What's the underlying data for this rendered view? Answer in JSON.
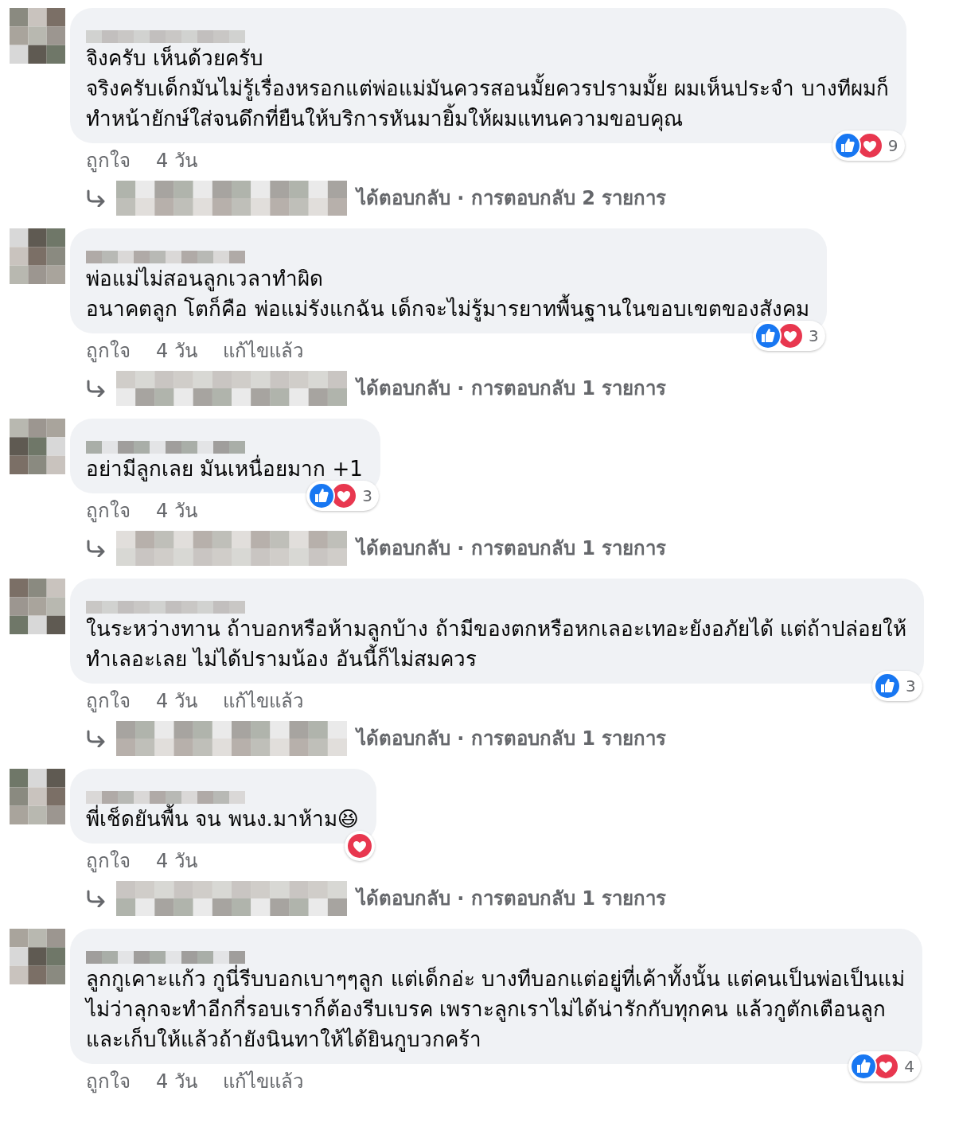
{
  "comments": [
    {
      "lines": [
        "จิงครับ เห็นด้วยครับ",
        "จริงครับเด็กมันไม่รู้เรื่องหรอกแต่พ่อแม่มันควรสอนมั้ยควรปรามมั้ย ผมเห็นประจำ บางทีผมก็",
        "ทำหน้ายักษ์ใส่จนดึกที่ยืนให้บริการหันมายิ้มให้ผมแทนความขอบคุณ"
      ],
      "reactions": [
        {
          "kind": "like"
        },
        {
          "kind": "love"
        }
      ],
      "reaction_count": "9",
      "like": "ถูกใจ",
      "time": "4 วัน",
      "reply": "ได้ตอบกลับ · การตอบกลับ 2 รายการ"
    },
    {
      "lines": [
        "พ่อแม่ไม่สอนลูกเวลาทำผิด",
        "อนาคตลูก โตก็คือ พ่อแม่รังแกฉัน เด็กจะไม่รู้มารยาทพื้นฐานในขอบเขตของสังคม"
      ],
      "reactions": [
        {
          "kind": "like"
        },
        {
          "kind": "love"
        }
      ],
      "reaction_count": "3",
      "like": "ถูกใจ",
      "time": "4 วัน",
      "edited": "แก้ไขแล้ว",
      "reply": "ได้ตอบกลับ · การตอบกลับ 1 รายการ"
    },
    {
      "lines": [
        "อย่ามีลูกเลย มันเหนื่อยมาก +1"
      ],
      "reactions": [
        {
          "kind": "like"
        },
        {
          "kind": "love"
        }
      ],
      "reaction_count": "3",
      "like": "ถูกใจ",
      "time": "4 วัน",
      "reply": "ได้ตอบกลับ · การตอบกลับ 1 รายการ"
    },
    {
      "lines": [
        "ในระหว่างทาน ถ้าบอกหรือห้ามลูกบ้าง ถ้ามีของตกหรือหกเลอะเทอะยังอภัยได้ แต่ถ้าปล่อยให้",
        "ทำเลอะเลย ไม่ได้ปรามน้อง อันนี้ก็ไม่สมควร"
      ],
      "reactions": [
        {
          "kind": "like"
        }
      ],
      "reaction_count": "3",
      "like": "ถูกใจ",
      "time": "4 วัน",
      "edited": "แก้ไขแล้ว",
      "reply": "ได้ตอบกลับ · การตอบกลับ 1 รายการ"
    },
    {
      "lines": [
        "พี่เช็ดยันพื้น จน พนง.มาห้าม😆"
      ],
      "reactions": [
        {
          "kind": "love"
        }
      ],
      "like": "ถูกใจ",
      "time": "4 วัน",
      "reply": "ได้ตอบกลับ · การตอบกลับ 1 รายการ"
    },
    {
      "lines": [
        "ลูกกูเคาะแก้ว กูนี่รีบบอกเบาๆๆลูก แต่เด็กอ่ะ บางทีบอกแต่อยู่ที่เค้าทั้งนั้น แต่คนเป็นพ่อเป็นแม่",
        "ไม่ว่าลุกจะทำอีกกี่รอบเราก็ต้องรีบเบรค เพราะลูกเราไม่ได้น่ารักกับทุกคน แล้วกูตักเตือนลูก",
        "และเก็บให้แล้วถ้ายังนินทาให้ได้ยินกูบวกคร้า"
      ],
      "reactions": [
        {
          "kind": "like"
        },
        {
          "kind": "love"
        }
      ],
      "reaction_count": "4",
      "like": "ถูกใจ",
      "time": "4 วัน",
      "edited": "แก้ไขแล้ว"
    }
  ]
}
